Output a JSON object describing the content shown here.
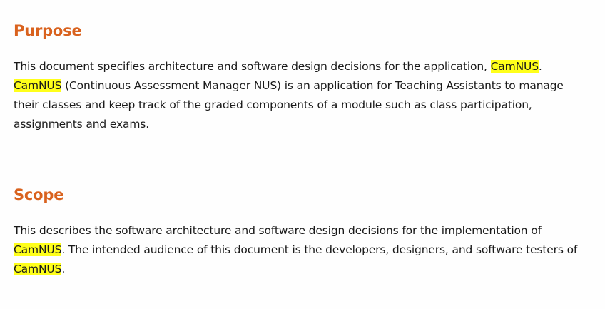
{
  "sections": [
    {
      "heading": "Purpose",
      "line1_a": "This document specifies architecture and software design decisions for the application, ",
      "line1_hl": "CamNUS",
      "line1_b": ".",
      "line2_hl": "CamNUS",
      "line2_b": " (Continuous Assessment Manager NUS) is an application for Teaching Assistants to manage",
      "line3": "their classes and keep track of the graded components of a module such as class participation,",
      "line4": "assignments and exams."
    },
    {
      "heading": "Scope",
      "line1": "This describes the software architecture and software design decisions for the implementation of",
      "line2_hl": "CamNUS",
      "line2_b": ". The intended audience of this document is the developers, designers, and software testers of",
      "line3_hl": "CamNUS",
      "line3_b": "."
    }
  ],
  "colors": {
    "heading": "#d9621e",
    "highlight": "#ffff1a",
    "text": "#1a1a1a"
  }
}
